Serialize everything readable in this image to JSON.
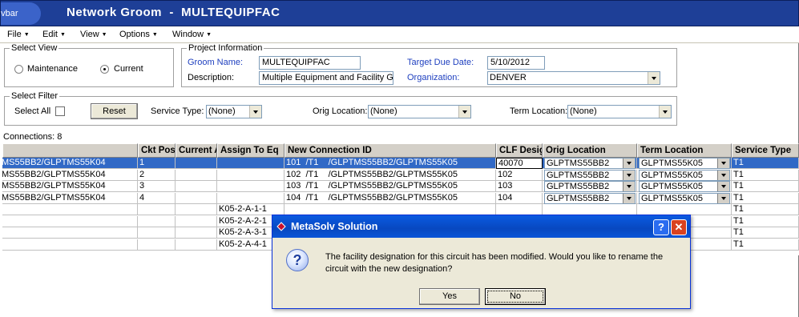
{
  "app": {
    "nav_tab": "avbar",
    "title": "Network Groom  -  MULTEQUIPFAC"
  },
  "menu": [
    {
      "label": "File"
    },
    {
      "label": "Edit"
    },
    {
      "label": "View"
    },
    {
      "label": "Options"
    },
    {
      "label": "Window"
    }
  ],
  "select_view": {
    "legend": "Select View",
    "options": [
      {
        "label": "Maintenance",
        "checked": false
      },
      {
        "label": "Current",
        "checked": true
      }
    ]
  },
  "project_info": {
    "legend": "Project Information",
    "groom_name_label": "Groom Name:",
    "groom_name_value": "MULTEQUIPFAC",
    "description_label": "Description:",
    "description_value": "Multiple Equipment and Facility Gro",
    "target_due_label": "Target Due Date:",
    "target_due_value": "5/10/2012",
    "organization_label": "Organization:",
    "organization_value": "DENVER"
  },
  "select_filter": {
    "legend": "Select Filter",
    "select_all_label": "Select All",
    "reset_label": "Reset",
    "service_type_label": "Service Type:",
    "service_type_value": "(None)",
    "orig_location_label": "Orig Location:",
    "orig_location_value": "(None)",
    "term_location_label": "Term Location:",
    "term_location_value": "(None)"
  },
  "connections_label": "Connections: 8",
  "grid": {
    "columns": [
      "",
      "Ckt Pos",
      "Current A",
      "Assign To Eq",
      "New Connection ID",
      "CLF Desig",
      "Orig Location",
      "Term Location",
      "Service Type"
    ],
    "rows": [
      {
        "conn": "MS55BB2/GLPTMS55K04",
        "ckt_pos": "1",
        "current": "",
        "assign": "",
        "new_id": "101  /T1    /GLPTMS55BB2/GLPTMS55K05",
        "clf": "40070",
        "orig": "GLPTMS55BB2",
        "term": "GLPTMS55K05",
        "service": "T1"
      },
      {
        "conn": "MS55BB2/GLPTMS55K04",
        "ckt_pos": "2",
        "current": "",
        "assign": "",
        "new_id": "102  /T1    /GLPTMS55BB2/GLPTMS55K05",
        "clf": "102",
        "orig": "GLPTMS55BB2",
        "term": "GLPTMS55K05",
        "service": "T1"
      },
      {
        "conn": "MS55BB2/GLPTMS55K04",
        "ckt_pos": "3",
        "current": "",
        "assign": "",
        "new_id": "103  /T1    /GLPTMS55BB2/GLPTMS55K05",
        "clf": "103",
        "orig": "GLPTMS55BB2",
        "term": "GLPTMS55K05",
        "service": "T1"
      },
      {
        "conn": "MS55BB2/GLPTMS55K04",
        "ckt_pos": "4",
        "current": "",
        "assign": "",
        "new_id": "104  /T1    /GLPTMS55BB2/GLPTMS55K05",
        "clf": "104",
        "orig": "GLPTMS55BB2",
        "term": "GLPTMS55K05",
        "service": "T1"
      },
      {
        "conn": "",
        "ckt_pos": "",
        "current": "",
        "assign": "K05-2-A-1-1",
        "new_id": "",
        "clf": "",
        "orig": "",
        "term": "",
        "service": "T1"
      },
      {
        "conn": "",
        "ckt_pos": "",
        "current": "",
        "assign": "K05-2-A-2-1",
        "new_id": "",
        "clf": "",
        "orig": "",
        "term": "",
        "service": "T1"
      },
      {
        "conn": "",
        "ckt_pos": "",
        "current": "",
        "assign": "K05-2-A-3-1",
        "new_id": "",
        "clf": "",
        "orig": "",
        "term": "",
        "service": "T1"
      },
      {
        "conn": "",
        "ckt_pos": "",
        "current": "",
        "assign": "K05-2-A-4-1",
        "new_id": "",
        "clf": "",
        "orig": "",
        "term": "",
        "service": "T1"
      }
    ]
  },
  "dialog": {
    "title": "MetaSolv Solution",
    "help_glyph": "?",
    "close_glyph": "✕",
    "message": "The facility designation for this circuit has been modified. Would you like to rename the circuit with the new designation?",
    "yes_label": "Yes",
    "no_label": "No"
  },
  "colors": {
    "title_bar": "#1e3f97",
    "selection": "#3169c6",
    "label_blue": "#1e3fbf",
    "dialog_title": "#0a5ae0"
  }
}
